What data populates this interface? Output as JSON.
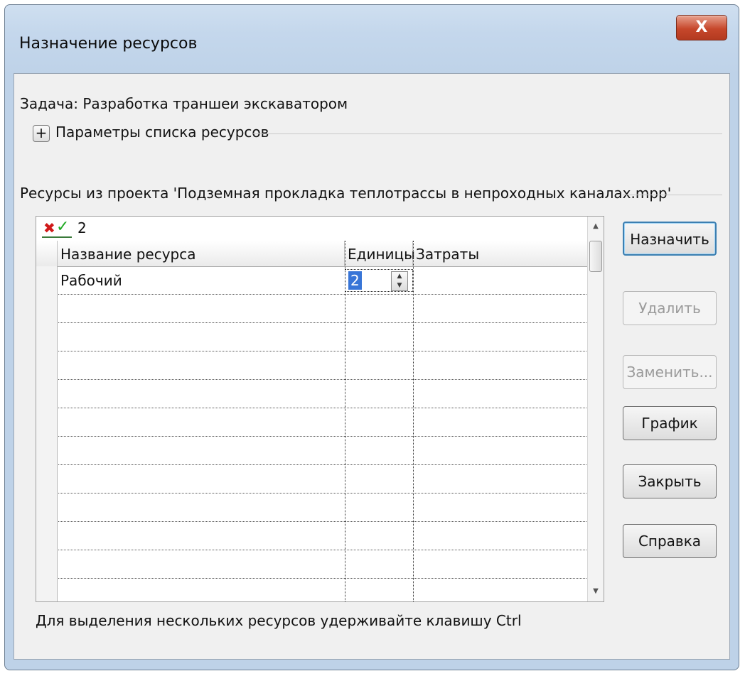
{
  "window": {
    "title": "Назначение ресурсов",
    "close_label": "X"
  },
  "task": {
    "label": "Задача: Разработка траншеи экскаватором"
  },
  "options": {
    "expand_symbol": "+",
    "label": "Параметры списка ресурсов"
  },
  "resources": {
    "section_label": "Ресурсы из проекта 'Подземная прокладка теплотрассы в непроходных каналах.mpp'",
    "edit_value": "2",
    "columns": [
      "Название ресурса",
      "Единицы",
      "Затраты"
    ],
    "rows": [
      {
        "name": "Рабочий",
        "units": "2",
        "cost": ""
      }
    ]
  },
  "buttons": {
    "assign": "Назначить",
    "remove": "Удалить",
    "replace": "Заменить...",
    "graphs": "График",
    "close": "Закрыть",
    "help": "Справка"
  },
  "hint": "Для выделения нескольких ресурсов удерживайте клавишу Ctrl",
  "colors": {
    "title_bar": "#c4d7ec",
    "close_button": "#c6472b",
    "selection": "#3875d7",
    "accept": "#1eaa22",
    "cancel": "#d01a1a"
  }
}
